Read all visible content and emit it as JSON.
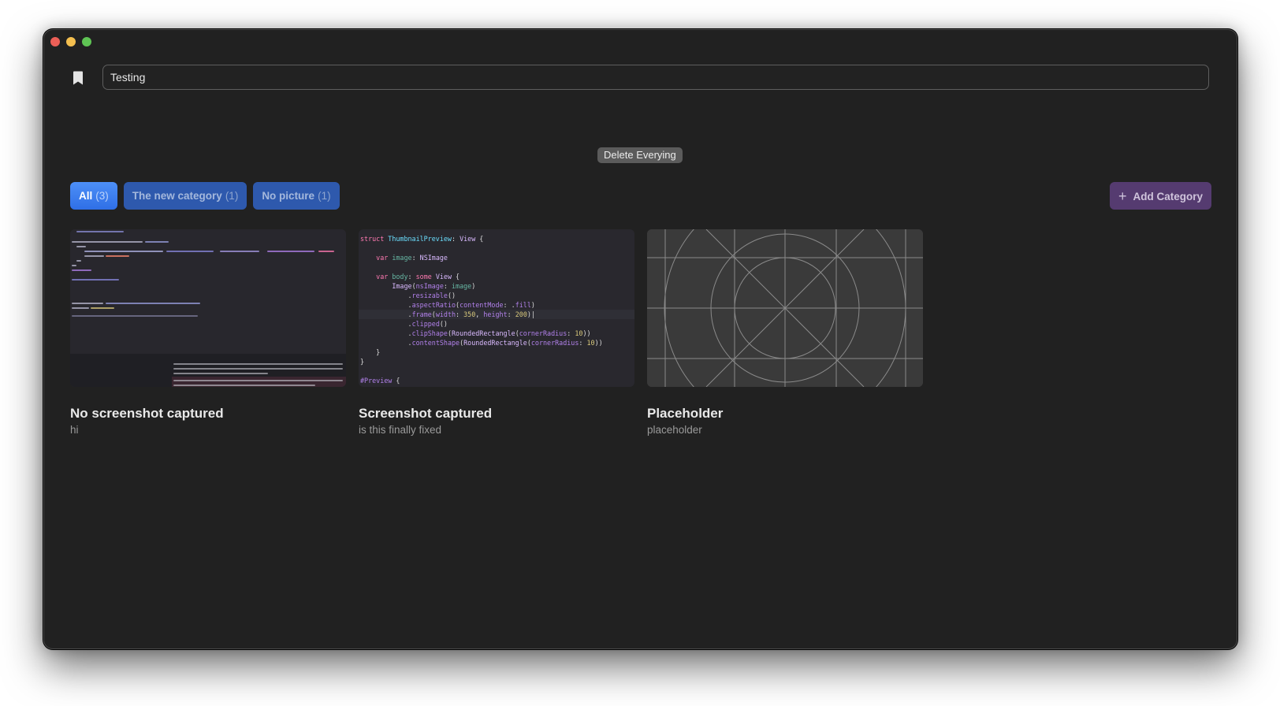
{
  "window": {
    "traffic_lights": [
      "close",
      "minimize",
      "maximize"
    ]
  },
  "toolbar": {
    "bookmark_icon": "bookmark-icon",
    "search_value": "Testing",
    "delete_label": "Delete Everying"
  },
  "categories": [
    {
      "label": "All",
      "count": "(3)",
      "active": true
    },
    {
      "label": "The new category",
      "count": "(1)",
      "active": false
    },
    {
      "label": "No picture",
      "count": "(1)",
      "active": false
    }
  ],
  "add_category": {
    "icon": "plus-icon",
    "label": "Add Category"
  },
  "cards": [
    {
      "title": "No screenshot captured",
      "subtitle": "hi",
      "thumbnail": "ide-screenshot"
    },
    {
      "title": "Screenshot captured",
      "subtitle": "is this finally fixed",
      "thumbnail": "code-screenshot"
    },
    {
      "title": "Placeholder",
      "subtitle": "placeholder",
      "thumbnail": "placeholder-grid"
    }
  ],
  "code_snippet": [
    [
      [
        "kw",
        "struct "
      ],
      [
        "nm",
        "ThumbnailPreview"
      ],
      [
        "",
        ": "
      ],
      [
        "ty",
        "View"
      ],
      [
        "",
        " {"
      ]
    ],
    [],
    [
      [
        "",
        "    "
      ],
      [
        "kw",
        "var "
      ],
      [
        "pr",
        "image"
      ],
      [
        "",
        ": "
      ],
      [
        "ty",
        "NSImage"
      ]
    ],
    [],
    [
      [
        "",
        "    "
      ],
      [
        "kw",
        "var "
      ],
      [
        "pr",
        "body"
      ],
      [
        "",
        ": "
      ],
      [
        "kw",
        "some "
      ],
      [
        "ty",
        "View"
      ],
      [
        "",
        " {"
      ]
    ],
    [
      [
        "",
        "        "
      ],
      [
        "ty",
        "Image"
      ],
      [
        "",
        "("
      ],
      [
        "fn",
        "nsImage"
      ],
      [
        "",
        ": "
      ],
      [
        "pr",
        "image"
      ],
      [
        "",
        ")"
      ]
    ],
    [
      [
        "",
        "            ."
      ],
      [
        "fn",
        "resizable"
      ],
      [
        "",
        "()"
      ]
    ],
    [
      [
        "",
        "            ."
      ],
      [
        "fn",
        "aspectRatio"
      ],
      [
        "",
        "("
      ],
      [
        "fn",
        "contentMode"
      ],
      [
        "",
        ": ."
      ],
      [
        "fn",
        "fill"
      ],
      [
        "",
        ")"
      ]
    ],
    [
      [
        "",
        "            ."
      ],
      [
        "fn",
        "frame"
      ],
      [
        "",
        "("
      ],
      [
        "fn",
        "width"
      ],
      [
        "",
        ": "
      ],
      [
        "num",
        "350"
      ],
      [
        "",
        ", "
      ],
      [
        "fn",
        "height"
      ],
      [
        "",
        ": "
      ],
      [
        "num",
        "200"
      ],
      [
        "",
        ")|"
      ]
    ],
    [
      [
        "",
        "            ."
      ],
      [
        "fn",
        "clipped"
      ],
      [
        "",
        "()"
      ]
    ],
    [
      [
        "",
        "            ."
      ],
      [
        "fn",
        "clipShape"
      ],
      [
        "",
        "("
      ],
      [
        "ty",
        "RoundedRectangle"
      ],
      [
        "",
        "("
      ],
      [
        "fn",
        "cornerRadius"
      ],
      [
        "",
        ": "
      ],
      [
        "num",
        "10"
      ],
      [
        "",
        "))"
      ]
    ],
    [
      [
        "",
        "            ."
      ],
      [
        "fn",
        "contentShape"
      ],
      [
        "",
        "("
      ],
      [
        "ty",
        "RoundedRectangle"
      ],
      [
        "",
        "("
      ],
      [
        "fn",
        "cornerRadius"
      ],
      [
        "",
        ": "
      ],
      [
        "num",
        "10"
      ],
      [
        "",
        "))"
      ]
    ],
    [
      [
        "",
        "    }"
      ]
    ],
    [
      [
        "",
        "}"
      ]
    ],
    [],
    [
      [
        "at",
        "#Preview"
      ],
      [
        "",
        " {"
      ]
    ]
  ]
}
